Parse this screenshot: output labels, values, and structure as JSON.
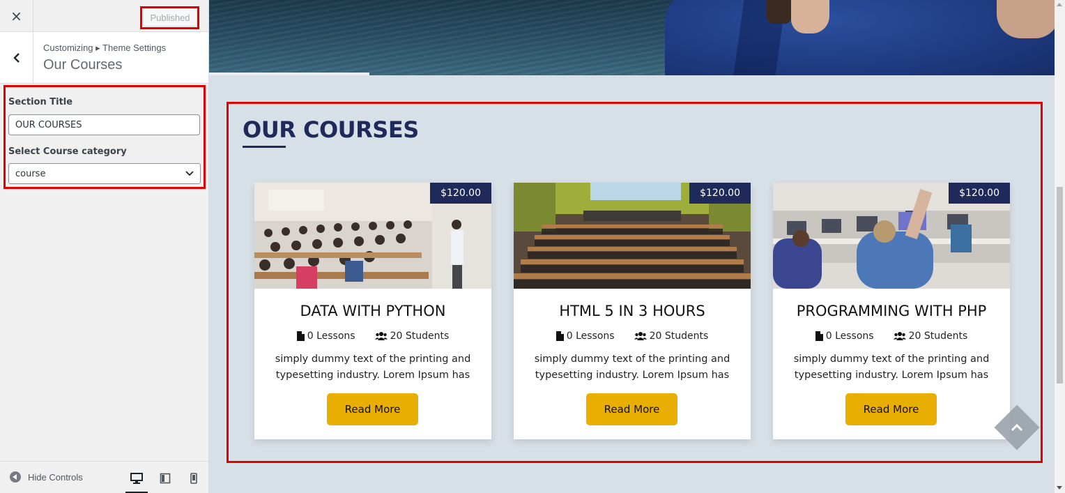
{
  "customizer": {
    "close_label": "×",
    "publish_button": "Published",
    "breadcrumb": "Customizing ▸ Theme Settings",
    "section_name": "Our Courses",
    "controls": {
      "section_title_label": "Section Title",
      "section_title_value": "OUR COURSES",
      "category_label": "Select Course category",
      "category_value": "course"
    },
    "footer": {
      "hide_controls": "Hide Controls",
      "devices": [
        "desktop-icon",
        "tablet-icon",
        "mobile-icon"
      ]
    }
  },
  "preview": {
    "section_title": "OUR COURSES",
    "courses": [
      {
        "price": "$120.00",
        "title": "DATA WITH PYTHON",
        "lessons": "0 Lessons",
        "students": "20 Students",
        "description": "simply dummy text of the printing and typesetting industry. Lorem Ipsum has",
        "button": "Read More"
      },
      {
        "price": "$120.00",
        "title": "HTML 5 IN 3 HOURS",
        "lessons": "0 Lessons",
        "students": "20 Students",
        "description": "simply dummy text of the printing and typesetting industry. Lorem Ipsum has",
        "button": "Read More"
      },
      {
        "price": "$120.00",
        "title": "PROGRAMMING WITH PHP",
        "lessons": "0 Lessons",
        "students": "20 Students",
        "description": "simply dummy text of the printing and typesetting industry. Lorem Ipsum has",
        "button": "Read More"
      }
    ]
  },
  "colors": {
    "highlight": "#e00000",
    "navy": "#1f2a5a",
    "button_yellow": "#e9ae02",
    "preview_bg": "#d8e0e7"
  }
}
